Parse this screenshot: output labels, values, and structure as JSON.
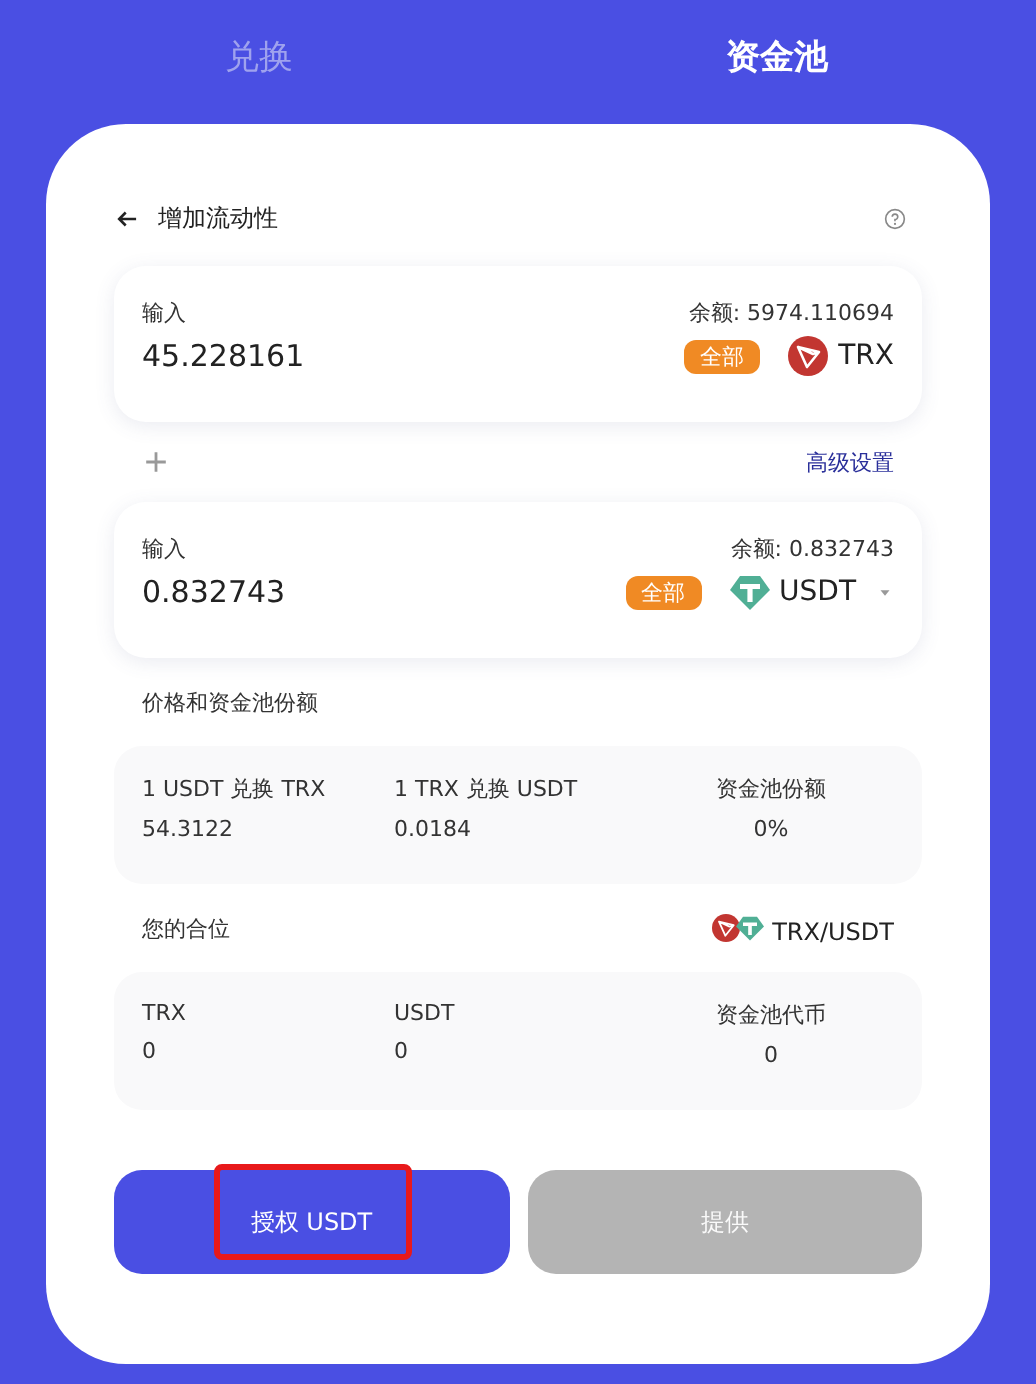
{
  "tabs": [
    {
      "label": "兑换",
      "selected": false
    },
    {
      "label": "资金池",
      "selected": true
    }
  ],
  "header": {
    "title": "增加流动性"
  },
  "inputs": [
    {
      "label": "输入",
      "balance": "余额: 5974.110694",
      "value": "45.228161",
      "max_label": "全部",
      "token": "TRX",
      "kind": "trx",
      "dropdown": false
    },
    {
      "label": "输入",
      "balance": "余额: 0.832743",
      "value": "0.832743",
      "max_label": "全部",
      "token": "USDT",
      "kind": "usdt",
      "dropdown": true
    }
  ],
  "advanced_settings": "高级设置",
  "price_section": {
    "title": "价格和资金池份额",
    "stats": [
      {
        "label": "1 USDT 兑换 TRX",
        "value": "54.3122"
      },
      {
        "label": "1 TRX 兑换 USDT",
        "value": "0.0184"
      },
      {
        "label": "资金池份额",
        "value": "0%"
      }
    ]
  },
  "position_section": {
    "title": "您的合位",
    "pair": "TRX/USDT",
    "stats": [
      {
        "label": "TRX",
        "value": "0"
      },
      {
        "label": "USDT",
        "value": "0"
      },
      {
        "label": "资金池代币",
        "value": "0"
      }
    ]
  },
  "buttons": [
    {
      "label": "授权 USDT",
      "kind": "primary",
      "highlighted": true
    },
    {
      "label": "提供",
      "kind": "disabled",
      "highlighted": false
    }
  ]
}
